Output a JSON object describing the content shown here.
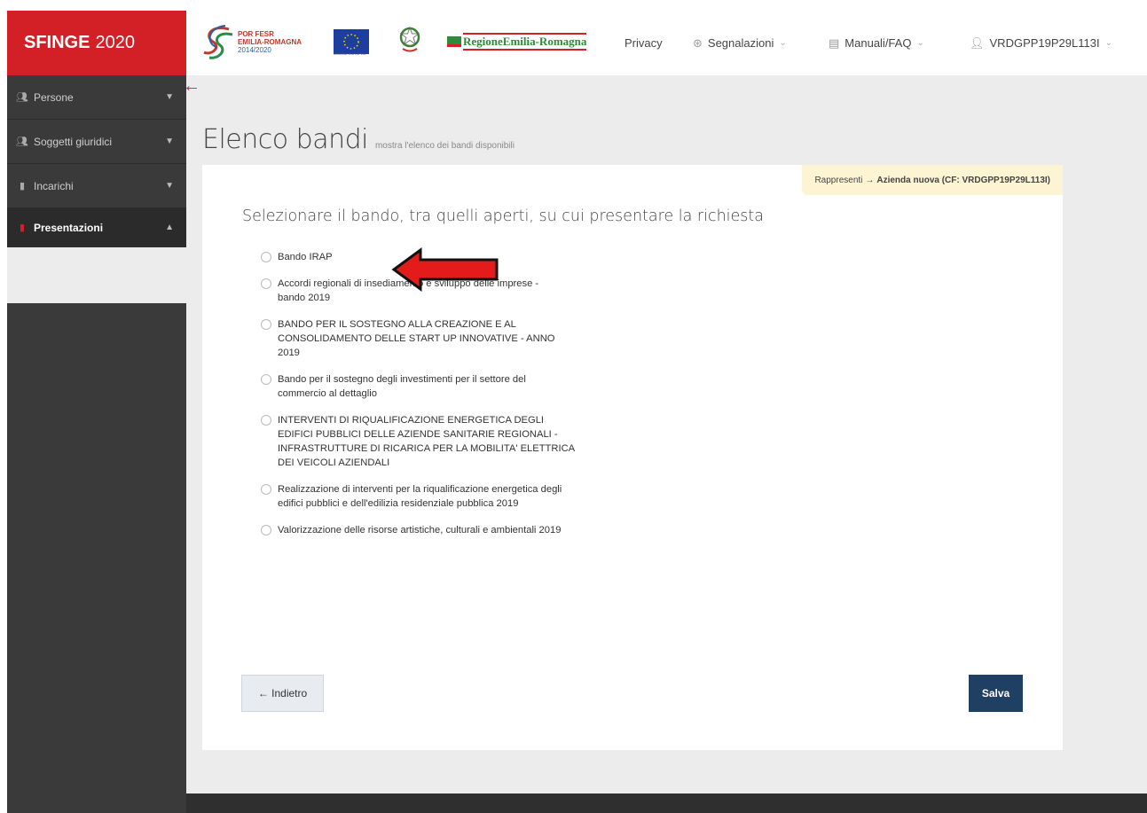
{
  "header": {
    "brand_bold": "SFINGE",
    "brand_year": "2020",
    "logo_por": {
      "line1": "POR FESR",
      "line2": "EMILIA-ROMAGNA",
      "line3": "2014/2020"
    },
    "logo_eu_caption": "UNIONE EUROPEA",
    "logo_rer": "RegioneEmilia-Romagna",
    "nav": {
      "privacy": "Privacy",
      "segnalazioni": "Segnalazioni",
      "manuali": "Manuali/FAQ",
      "user": "VRDGPP19P29L113I"
    }
  },
  "sidebar": {
    "items": [
      {
        "label": "Persone",
        "icon": "users-icon"
      },
      {
        "label": "Soggetti giuridici",
        "icon": "users-icon"
      },
      {
        "label": "Incarichi",
        "icon": "file-icon"
      },
      {
        "label": "Presentazioni",
        "icon": "file-icon"
      }
    ]
  },
  "page": {
    "title": "Elenco bandi",
    "subtitle": "mostra l'elenco dei bandi disponibili"
  },
  "panel": {
    "rappresenti_prefix": "Rappresenti",
    "rappresenti_arrow": "→",
    "rappresenti_value": "Azienda nuova (CF: VRDGPP19P29L113I)",
    "heading": "Selezionare il bando, tra quelli aperti, su cui presentare la richiesta",
    "bandi": [
      "Bando IRAP",
      "Accordi regionali di insediamento e sviluppo delle imprese - bando 2019",
      "BANDO PER IL SOSTEGNO ALLA CREAZIONE E AL CONSOLIDAMENTO DELLE START UP INNOVATIVE - ANNO 2019",
      "Bando per il sostegno degli investimenti per il settore del commercio al dettaglio",
      "INTERVENTI DI RIQUALIFICAZIONE ENERGETICA DEGLI EDIFICI PUBBLICI DELLE AZIENDE SANITARIE REGIONALI - INFRASTRUTTURE DI RICARICA PER LA MOBILITA' ELETTRICA DEI VEICOLI AZIENDALI",
      "Realizzazione di interventi per la riqualificazione energetica degli edifici pubblici e dell'edilizia residenziale pubblica 2019",
      "Valorizzazione delle risorse artistiche, culturali e ambientali 2019"
    ],
    "back_label": "← Indietro",
    "save_label": "Salva"
  },
  "colors": {
    "brand_red": "#d32027",
    "sidebar_bg": "#3a3a3a",
    "save_button": "#1f3f63",
    "notice_bg": "#fdf4d3"
  }
}
